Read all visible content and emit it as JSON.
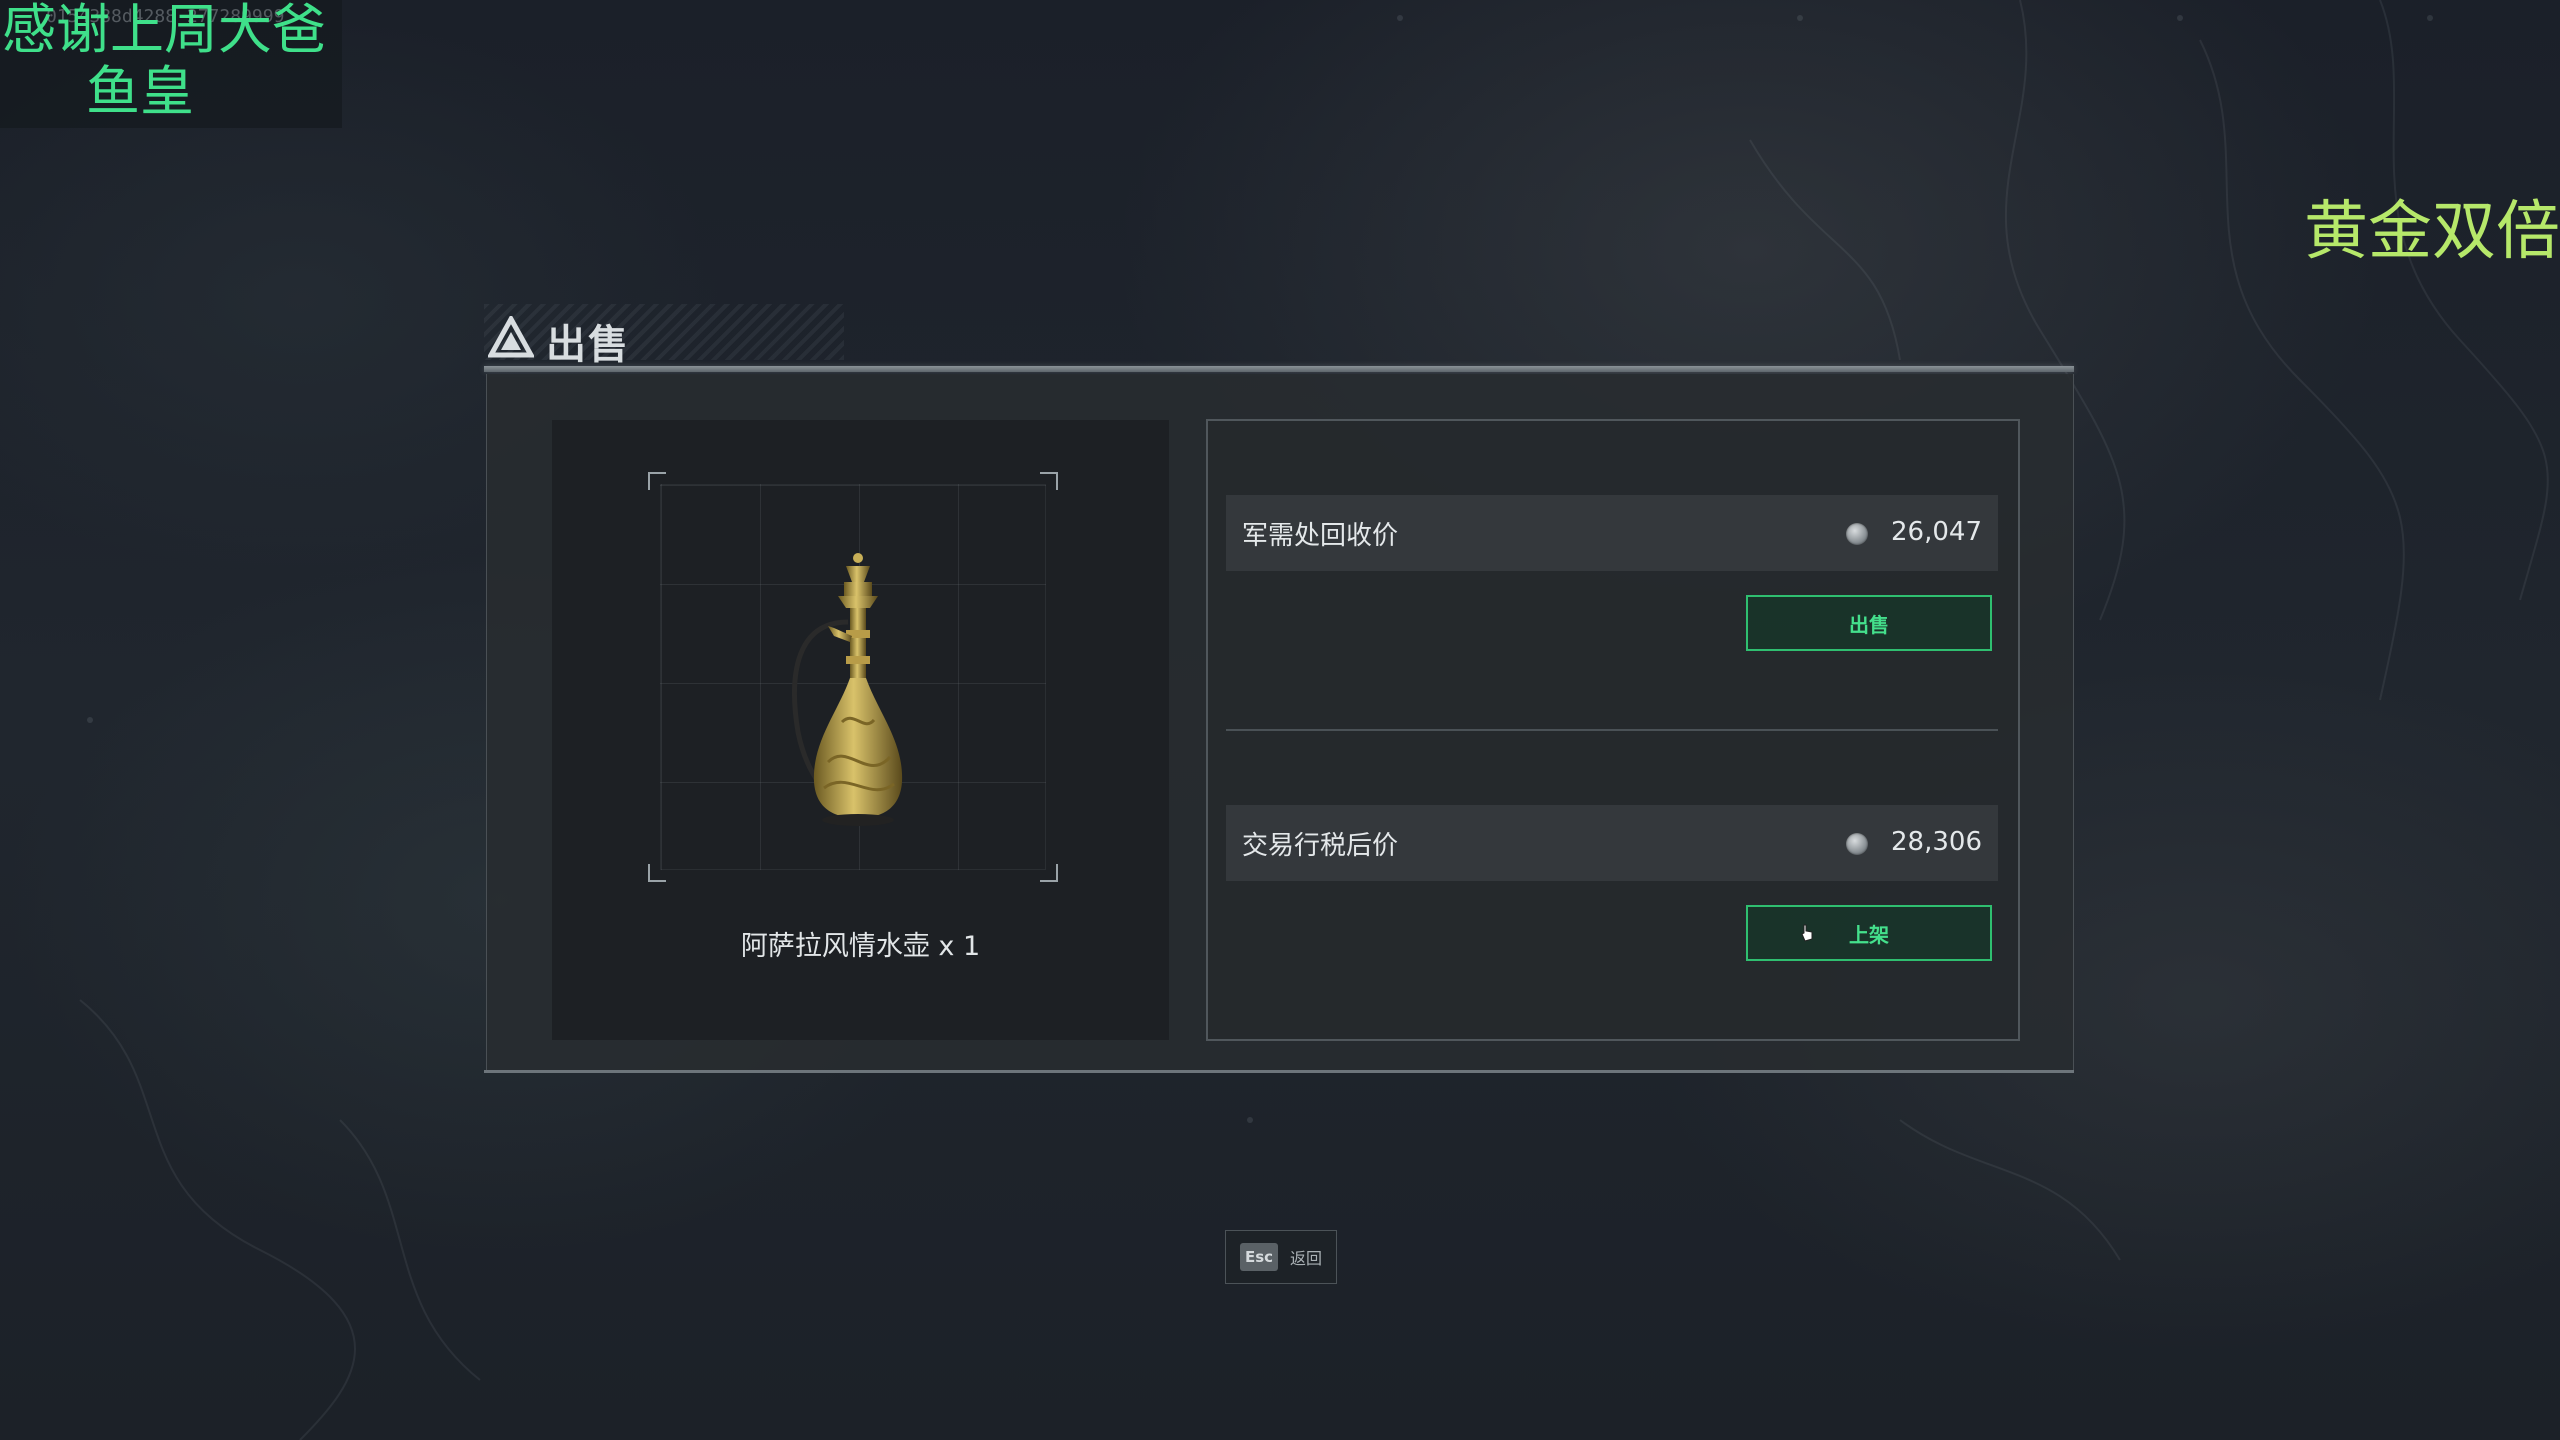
{
  "overlay": {
    "thanks_line1": "感谢上周大爸",
    "thanks_line2": "鱼皇",
    "uid_faint": "0154388d4288  277289999",
    "promo": "黄金双倍"
  },
  "dialog": {
    "title": "出售",
    "item": {
      "name": "阿萨拉风情水壶 x 1",
      "icon": "ewer-icon"
    },
    "recycle": {
      "label": "军需处回收价",
      "price": "26,047",
      "button_label": "出售"
    },
    "market": {
      "label": "交易行税后价",
      "price": "28,306",
      "button_label": "上架"
    },
    "colors": {
      "accent_green": "#2fbf70",
      "overlay_green": "#3fe08a",
      "promo_yellow": "#b6e86a"
    }
  },
  "footer": {
    "esc_key": "Esc",
    "esc_label": "返回"
  }
}
